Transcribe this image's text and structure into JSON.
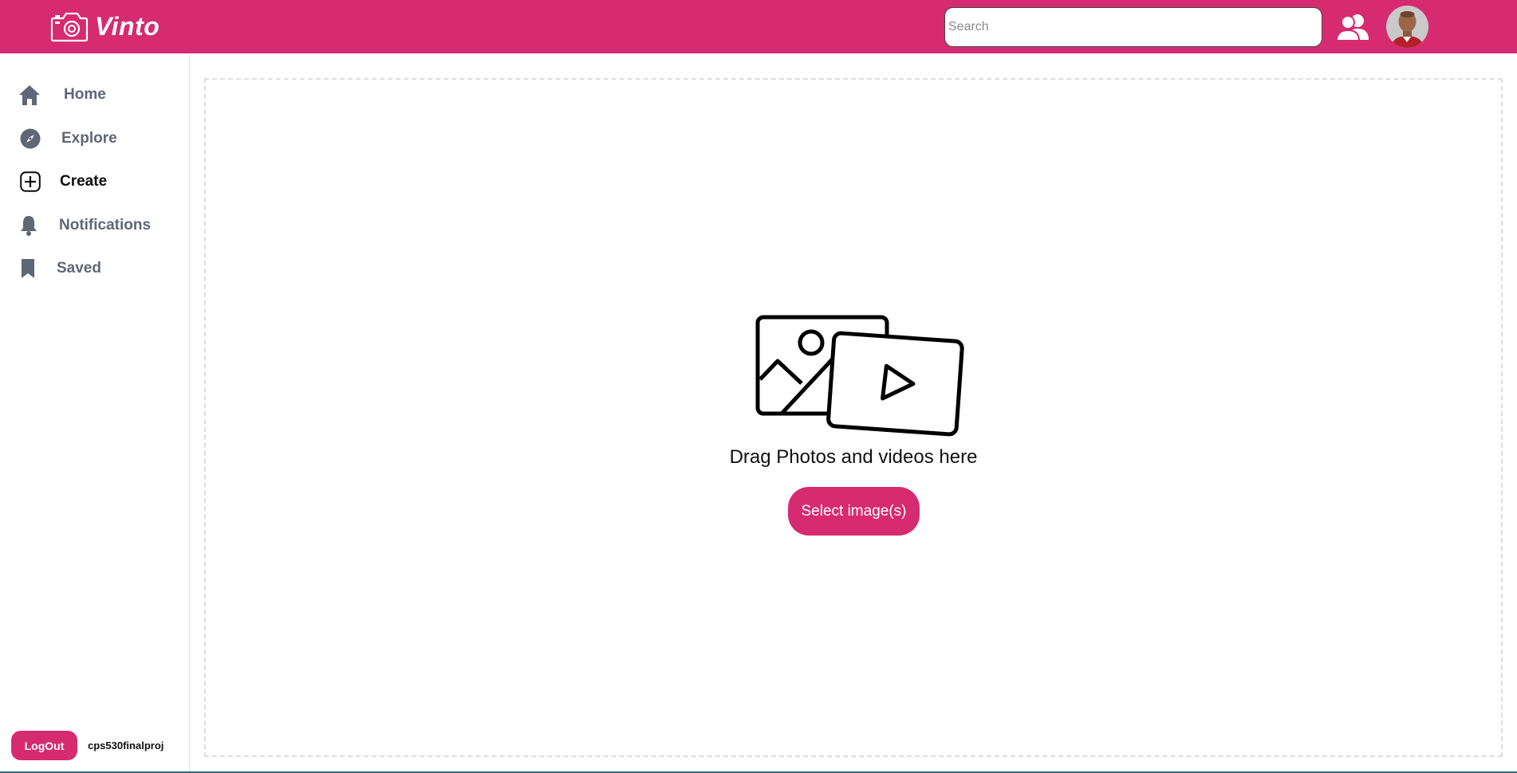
{
  "header": {
    "brand_name": "Vinto",
    "search_placeholder": "Search",
    "color": "#d62b70"
  },
  "sidebar": {
    "items": [
      {
        "label": "Home",
        "icon": "home-icon",
        "active": false
      },
      {
        "label": "Explore",
        "icon": "compass-icon",
        "active": false
      },
      {
        "label": "Create",
        "icon": "plus-square-icon",
        "active": true
      },
      {
        "label": "Notifications",
        "icon": "bell-icon",
        "active": false
      },
      {
        "label": "Saved",
        "icon": "bookmark-icon",
        "active": false
      }
    ],
    "logout_label": "LogOut",
    "username": "cps530finalproj"
  },
  "main": {
    "drag_text": "Drag Photos and videos here",
    "select_button_label": "Select image(s)"
  }
}
